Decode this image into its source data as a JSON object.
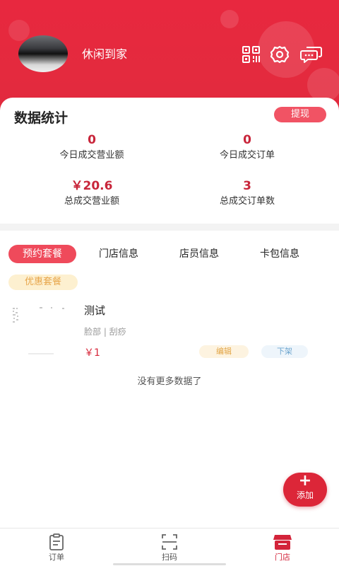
{
  "colors": {
    "primary": "#e12b3d",
    "accent_pink": "#ef4a5b",
    "price": "#d7283b",
    "gold": "#e7a54a"
  },
  "header": {
    "shop_name": "休闲到家",
    "icons": [
      "qrcode-icon",
      "gear-icon",
      "message-icon"
    ]
  },
  "stats": {
    "title": "数据统计",
    "withdraw_label": "提现",
    "today_revenue": {
      "value": "0",
      "label": "今日成交营业额"
    },
    "today_orders": {
      "value": "0",
      "label": "今日成交订单"
    },
    "total_revenue": {
      "value": "￥20.6",
      "label": "总成交营业额"
    },
    "total_orders": {
      "value": "3",
      "label": "总成交订单数"
    }
  },
  "tabs": [
    "预约套餐",
    "门店信息",
    "店员信息",
    "卡包信息"
  ],
  "subtab": "优惠套餐",
  "items": [
    {
      "name": "测试",
      "tags": "脸部 | 刮痧",
      "price": "￥1",
      "edit_label": "编辑",
      "off_label": "下架"
    }
  ],
  "list_end_text": "没有更多数据了",
  "fab_label": "添加",
  "bottom_nav": [
    {
      "label": "订单",
      "icon": "clipboard-icon"
    },
    {
      "label": "扫码",
      "icon": "scan-icon"
    },
    {
      "label": "门店",
      "icon": "store-icon"
    }
  ]
}
